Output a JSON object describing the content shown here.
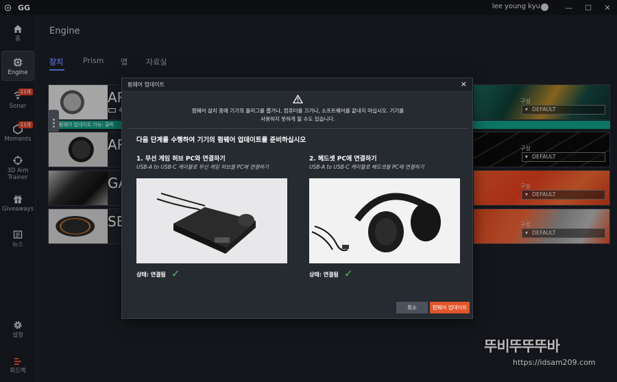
{
  "titlebar": {
    "app_name": "GG",
    "user_name": "lee young kyu",
    "minimize": "—",
    "maximize": "☐",
    "close": "✕"
  },
  "sidebar": {
    "items": [
      {
        "label": "홈",
        "icon": "home-icon"
      },
      {
        "label": "Engine",
        "icon": "engine-chip-icon",
        "active": true
      },
      {
        "label": "Sonar",
        "icon": "sonar-icon",
        "badge": "11개"
      },
      {
        "label": "Moments",
        "icon": "moments-hexagon-icon",
        "badge": "11개"
      },
      {
        "label": "3D Aim Trainer",
        "icon": "crosshair-icon"
      },
      {
        "label": "Giveaways",
        "icon": "gift-icon"
      },
      {
        "label": "뉴스",
        "icon": "news-icon"
      },
      {
        "label": "설정",
        "icon": "gear-icon"
      },
      {
        "label": "피드백",
        "icon": "feedback-icon"
      }
    ]
  },
  "page": {
    "title": "Engine"
  },
  "tabs": [
    {
      "label": "장치",
      "active": true
    },
    {
      "label": "Prism"
    },
    {
      "label": "앱"
    },
    {
      "label": "자료실"
    }
  ],
  "devices": [
    {
      "name": "AR",
      "config_label": "구성",
      "config_value": "DEFAULT",
      "battery": "4"
    },
    {
      "name": "AR",
      "config_label": "구성",
      "config_value": "DEFAULT"
    },
    {
      "name": "GA",
      "config_label": "구성",
      "config_value": "DEFAULT"
    },
    {
      "name": "SE",
      "config_label": "구성",
      "config_value": "DEFAULT"
    }
  ],
  "firmware_strip": {
    "text": "펌웨어 업데이트 가능: 클릭"
  },
  "modal": {
    "title": "펌웨어 업데이트",
    "close": "×",
    "warning_line1": "펌웨어 설치 중에 기기의 플러그를 뽑거나, 컴퓨터를 끄거나, 소프트웨어를 끝내지 마십시오. 기기를",
    "warning_line2": "사용하지 못하게 될 수도 있습니다.",
    "instruction": "다음 단계를 수행하여 기기의 펌웨어 업데이트를 준비하십시오",
    "steps": [
      {
        "title": "1. 무선 게임 허브 PC와 연결하기",
        "subtitle": "USB-A to USB-C 케이블로 무선 게임 허브를 PC에 연결하기",
        "status": "상태: 연결됨",
        "check": "✓"
      },
      {
        "title": "2. 헤드셋 PC에 연결하기",
        "subtitle": "USB-A to USB-C 케이블로 헤드셋을 PC에 연결하기",
        "status": "상태: 연결됨",
        "check": "✓"
      }
    ],
    "cancel_label": "취소",
    "update_label": "펌웨어 업데이트"
  },
  "watermark": {
    "text": "뚜비뚜뚜뚜바",
    "url": "https://idsam209.com"
  },
  "colors": {
    "accent": "#6c87ff",
    "update_button": "#e2542a",
    "connected_check": "#4ec25a",
    "firmware_strip": "#11a38a",
    "badge": "#e0452f"
  }
}
